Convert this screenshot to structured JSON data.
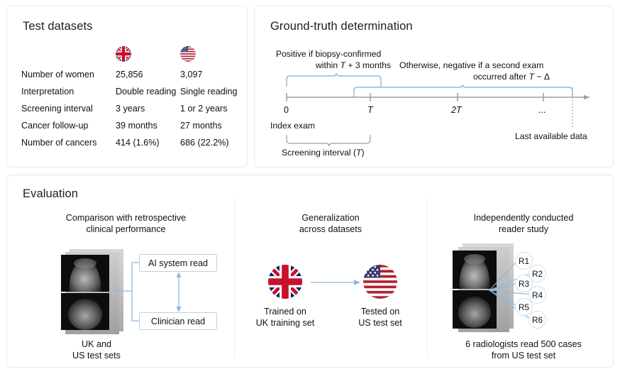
{
  "panels": {
    "datasets": {
      "title": "Test datasets",
      "columns": [
        "",
        "uk-flag",
        "us-flag"
      ],
      "rows": [
        {
          "label": "Number of women",
          "uk": "25,856",
          "us": "3,097"
        },
        {
          "label": "Interpretation",
          "uk": "Double reading",
          "us": "Single reading"
        },
        {
          "label": "Screening interval",
          "uk": "3 years",
          "us": "1 or 2 years"
        },
        {
          "label": "Cancer follow-up",
          "uk": "39 months",
          "us": "27 months"
        },
        {
          "label": "Number of cancers",
          "uk": "414 (1.6%)",
          "us": "686 (22.2%)"
        }
      ]
    },
    "ground_truth": {
      "title": "Ground-truth determination",
      "positive_note_line1": "Positive if biopsy-confirmed",
      "positive_note_line2_pre": "within ",
      "positive_note_line2_var": "T",
      "positive_note_line2_post": " + 3 months",
      "negative_note_line1": "Otherwise, negative if a second exam",
      "negative_note_line2_pre": "occurred after ",
      "negative_note_line2_var": "T",
      "negative_note_line2_post": " − Δ",
      "tick_labels": [
        "0",
        "T",
        "2T",
        "..."
      ],
      "index_exam_label": "Index exam",
      "last_data_label": "Last available data",
      "screening_interval_pre": "Screening interval (",
      "screening_interval_var": "T",
      "screening_interval_post": ")"
    },
    "evaluation": {
      "title": "Evaluation",
      "columns": [
        {
          "title_line1": "Comparison with retrospective",
          "title_line2": "clinical performance",
          "box_ai": "AI system read",
          "box_clinician": "Clinician read",
          "caption_line1": "UK and",
          "caption_line2": "US test sets"
        },
        {
          "title_line1": "Generalization",
          "title_line2": "across datasets",
          "left_caption_line1": "Trained on",
          "left_caption_line2": "UK training set",
          "right_caption_line1": "Tested on",
          "right_caption_line2": "US test set"
        },
        {
          "title_line1": "Independently conducted",
          "title_line2": "reader study",
          "readers": [
            "R1",
            "R2",
            "R3",
            "R4",
            "R5",
            "R6"
          ],
          "caption_line1": "6 radiologists read 500 cases",
          "caption_line2": "from US test set"
        }
      ]
    }
  },
  "colors": {
    "panel_border": "#e8e8e8",
    "accent_blue": "#8fb8de",
    "box_border": "#b9d3ea",
    "axis_gray": "#9e9e9e",
    "text": "#111111",
    "uk_red": "#c8102e",
    "uk_blue": "#012169",
    "us_red": "#b22234",
    "us_blue": "#3c3b6e"
  }
}
